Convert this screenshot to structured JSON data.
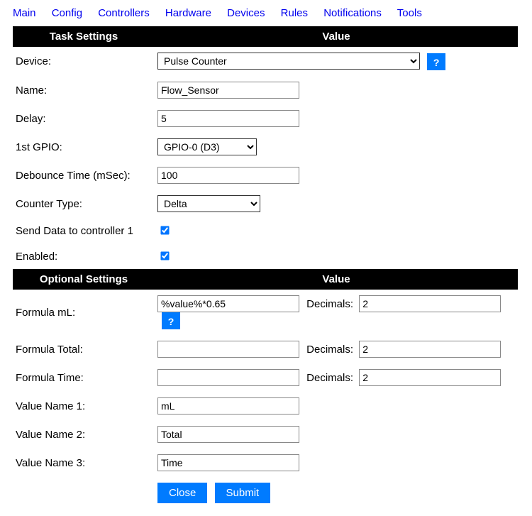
{
  "nav": [
    "Main",
    "Config",
    "Controllers",
    "Hardware",
    "Devices",
    "Rules",
    "Notifications",
    "Tools"
  ],
  "header1": {
    "left": "Task Settings",
    "right": "Value"
  },
  "header2": {
    "left": "Optional Settings",
    "right": "Value"
  },
  "labels": {
    "device": "Device:",
    "name": "Name:",
    "delay": "Delay:",
    "gpio": "1st GPIO:",
    "debounce": "Debounce Time (mSec):",
    "counterType": "Counter Type:",
    "sendData": "Send Data to controller 1",
    "enabled": "Enabled:",
    "formulaML": "Formula mL:",
    "formulaTotal": "Formula Total:",
    "formulaTime": "Formula Time:",
    "decimals": "Decimals:",
    "val1": "Value Name 1:",
    "val2": "Value Name 2:",
    "val3": "Value Name 3:"
  },
  "values": {
    "device": "Pulse Counter",
    "name": "Flow_Sensor",
    "delay": "5",
    "gpio": "GPIO-0 (D3)",
    "debounce": "100",
    "counterType": "Delta",
    "sendData": true,
    "enabled": true,
    "formulaML": "%value%*0.65",
    "formulaTotal": "",
    "formulaTime": "",
    "decML": "2",
    "decTotal": "2",
    "decTime": "2",
    "val1": "mL",
    "val2": "Total",
    "val3": "Time"
  },
  "buttons": {
    "help": "?",
    "close": "Close",
    "submit": "Submit"
  }
}
